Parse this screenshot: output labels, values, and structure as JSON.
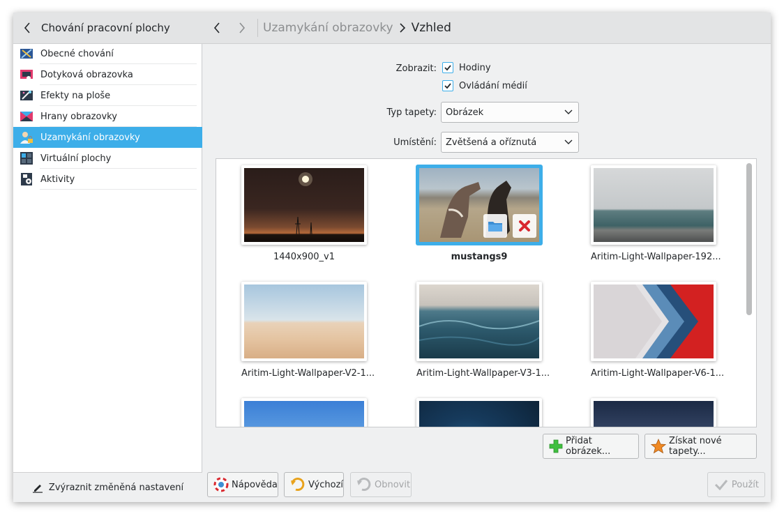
{
  "sidebar": {
    "header": "Chování pracovní plochy",
    "items": [
      {
        "label": "Obecné chování",
        "icon": "general-behavior-icon"
      },
      {
        "label": "Dotyková obrazovka",
        "icon": "touchscreen-icon"
      },
      {
        "label": "Efekty na ploše",
        "icon": "desktop-effects-icon"
      },
      {
        "label": "Hrany obrazovky",
        "icon": "screen-edges-icon"
      },
      {
        "label": "Uzamykání obrazovky",
        "icon": "screen-lock-icon",
        "active": true
      },
      {
        "label": "Virtuální plochy",
        "icon": "virtual-desktops-icon"
      },
      {
        "label": "Aktivity",
        "icon": "activities-icon"
      }
    ],
    "footer": "Zvýraznit změněná nastavení"
  },
  "breadcrumb": {
    "parent": "Uzamykání obrazovky",
    "current": "Vzhled"
  },
  "form": {
    "show_label": "Zobrazit:",
    "clock_label": "Hodiny",
    "clock_checked": true,
    "media_label": "Ovládání médií",
    "media_checked": true,
    "wallpaper_type_label": "Typ tapety:",
    "wallpaper_type_value": "Obrázek",
    "position_label": "Umístění:",
    "position_value": "Zvětšená a oříznutá"
  },
  "wallpapers": [
    {
      "name": "1440x900_v1"
    },
    {
      "name": "mustangs9",
      "selected": true
    },
    {
      "name": "Aritim-Light-Wallpaper-192..."
    },
    {
      "name": "Aritim-Light-Wallpaper-V2-1..."
    },
    {
      "name": "Aritim-Light-Wallpaper-V3-1..."
    },
    {
      "name": "Aritim-Light-Wallpaper-V6-1..."
    }
  ],
  "actions": {
    "add_image": "Přidat obrázek...",
    "get_new": "Získat nové tapety..."
  },
  "footer_buttons": {
    "help": "Nápověda",
    "defaults": "Výchozí",
    "reset": "Obnovit",
    "apply": "Použít"
  },
  "colors": {
    "accent": "#3daee9",
    "text": "#232629",
    "window_bg": "#eff0f1"
  }
}
